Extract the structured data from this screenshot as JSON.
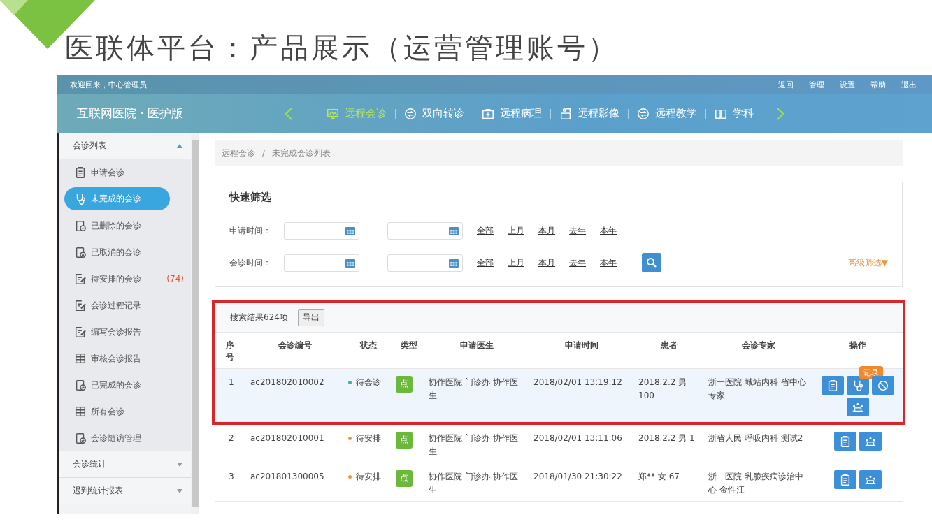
{
  "slide": {
    "title": "医联体平台：产品展示（运营管理账号）"
  },
  "top_bar": {
    "welcome": "欢迎回来，中心管理员",
    "links": [
      "返回",
      "管理",
      "设置",
      "帮助",
      "退出"
    ]
  },
  "header": {
    "brand": "互联网医院 · 医护版",
    "nav": [
      {
        "label": "远程会诊",
        "kind": "monitor",
        "selected": true
      },
      {
        "label": "双向转诊",
        "kind": "swap",
        "selected": false
      },
      {
        "label": "远程病理",
        "kind": "kit",
        "selected": false
      },
      {
        "label": "远程影像",
        "kind": "board",
        "selected": false
      },
      {
        "label": "远程教学",
        "kind": "swap",
        "selected": false
      },
      {
        "label": "学科",
        "kind": "book",
        "selected": false
      }
    ]
  },
  "sidebar": {
    "groups": [
      {
        "label": "会诊列表",
        "expanded": true,
        "items": [
          {
            "label": "申请会诊",
            "kind": "clipboard",
            "selected": false
          },
          {
            "label": "未完成的会诊",
            "kind": "stethoscope",
            "selected": true
          },
          {
            "label": "已删除的会诊",
            "kind": "minus",
            "selected": false
          },
          {
            "label": "已取消的会诊",
            "kind": "cross",
            "selected": false
          },
          {
            "label": "待安排的会诊",
            "kind": "edit",
            "selected": false,
            "count": "(74)"
          },
          {
            "label": "会诊过程记录",
            "kind": "edit",
            "selected": false
          },
          {
            "label": "编写会诊报告",
            "kind": "edit",
            "selected": false
          },
          {
            "label": "审核会诊报告",
            "kind": "grid",
            "selected": false
          },
          {
            "label": "已完成的会诊",
            "kind": "check",
            "selected": false
          },
          {
            "label": "所有会诊",
            "kind": "grid",
            "selected": false
          },
          {
            "label": "会诊随访管理",
            "kind": "check",
            "selected": false
          }
        ]
      },
      {
        "label": "会诊统计",
        "expanded": false
      },
      {
        "label": "迟到统计报表",
        "expanded": false
      }
    ]
  },
  "breadcrumb": {
    "items": [
      "远程会诊",
      "未完成会诊列表"
    ],
    "separator": "/"
  },
  "filter": {
    "title": "快速筛选",
    "separator": "—",
    "rows": [
      {
        "label": "申请时间：",
        "links": [
          "全部",
          "上月",
          "本月",
          "去年",
          "本年"
        ],
        "search": false
      },
      {
        "label": "会诊时间：",
        "links": [
          "全部",
          "上月",
          "本月",
          "去年",
          "本年"
        ],
        "search": true
      }
    ],
    "advanced": "高级筛选▼"
  },
  "results": {
    "summary": "搜索结果624项",
    "export": "导出",
    "columns": [
      "序号",
      "会诊编号",
      "状态",
      "类型",
      "申请医生",
      "申请时间",
      "患者",
      "会诊专家",
      "操作"
    ],
    "rows": [
      {
        "no": "1",
        "id": "ac201802010002",
        "status": "待会诊",
        "color": "#3bb4a8",
        "type": "点",
        "doctor": "协作医院 门诊办 协作医生",
        "time": "2018/02/01 13:19:12",
        "patient": "2018.2.2 男 100",
        "expert": "浙一医院 城站内科 省中心专家",
        "selected": true,
        "highlighted": true,
        "actions": [
          {
            "kind": "clipboard"
          },
          {
            "kind": "stethoscope",
            "tooltip": "记录"
          },
          {
            "kind": "blocked"
          },
          {
            "kind": "meeting"
          }
        ]
      },
      {
        "no": "2",
        "id": "ac201802010001",
        "status": "待安排",
        "color": "#f0953e",
        "type": "点",
        "doctor": "协作医院 门诊办 协作医生",
        "time": "2018/02/01 13:11:06",
        "patient": "2018.2.2 男 1",
        "expert": "浙省人民 呼吸内科 测试2",
        "selected": false,
        "highlighted": false,
        "actions": [
          {
            "kind": "clipboard"
          },
          {
            "kind": "meeting"
          }
        ]
      },
      {
        "no": "3",
        "id": "ac201801300005",
        "status": "待安排",
        "color": "#f0953e",
        "type": "点",
        "doctor": "协作医院 门诊办 协作医生",
        "time": "2018/01/30 21:30:22",
        "patient": "郑** 女 67",
        "expert": "浙一医院 乳腺疾病诊治中心 金性江",
        "selected": false,
        "highlighted": false,
        "actions": [
          {
            "kind": "clipboard"
          },
          {
            "kind": "meeting"
          }
        ]
      }
    ]
  }
}
